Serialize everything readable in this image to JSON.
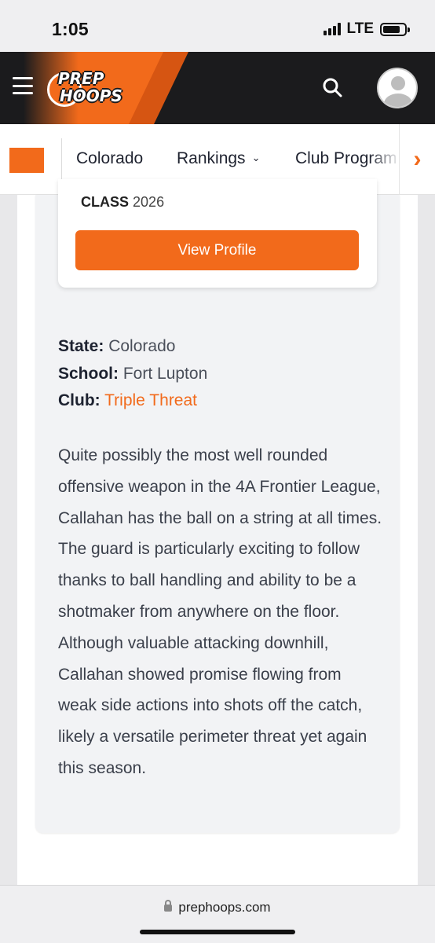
{
  "status_bar": {
    "time": "1:05",
    "network": "LTE"
  },
  "header": {
    "logo_line1": "PREP",
    "logo_line2": "HOOPS"
  },
  "subnav": {
    "items": [
      {
        "label": "Colorado"
      },
      {
        "label": "Rankings",
        "has_dropdown": true
      },
      {
        "label": "Club Program"
      }
    ],
    "arrow": "›"
  },
  "profile_card": {
    "class_label": "CLASS",
    "class_year": "2026",
    "view_profile_label": "View Profile"
  },
  "details": {
    "state_label": "State:",
    "state_value": "Colorado",
    "school_label": "School:",
    "school_value": "Fort Lupton",
    "club_label": "Club:",
    "club_value": "Triple Threat"
  },
  "bio": "Quite possibly the most well rounded offensive weapon in the 4A Frontier League, Callahan has the ball on a string at all times. The guard is particularly exciting to follow thanks to ball handling and ability to be a shotmaker from anywhere on the floor. Although valuable attacking downhill, Callahan showed promise flowing from weak side actions into shots off the catch, likely a versatile perimeter threat yet again this season.",
  "browser": {
    "url": "prephoops.com"
  },
  "colors": {
    "accent": "#f26a1b",
    "header_bg": "#1b1b1d"
  },
  "icons": [
    "hamburger-icon",
    "search-icon",
    "avatar-icon",
    "chevron-down-icon",
    "chevron-right-icon",
    "lock-icon"
  ]
}
